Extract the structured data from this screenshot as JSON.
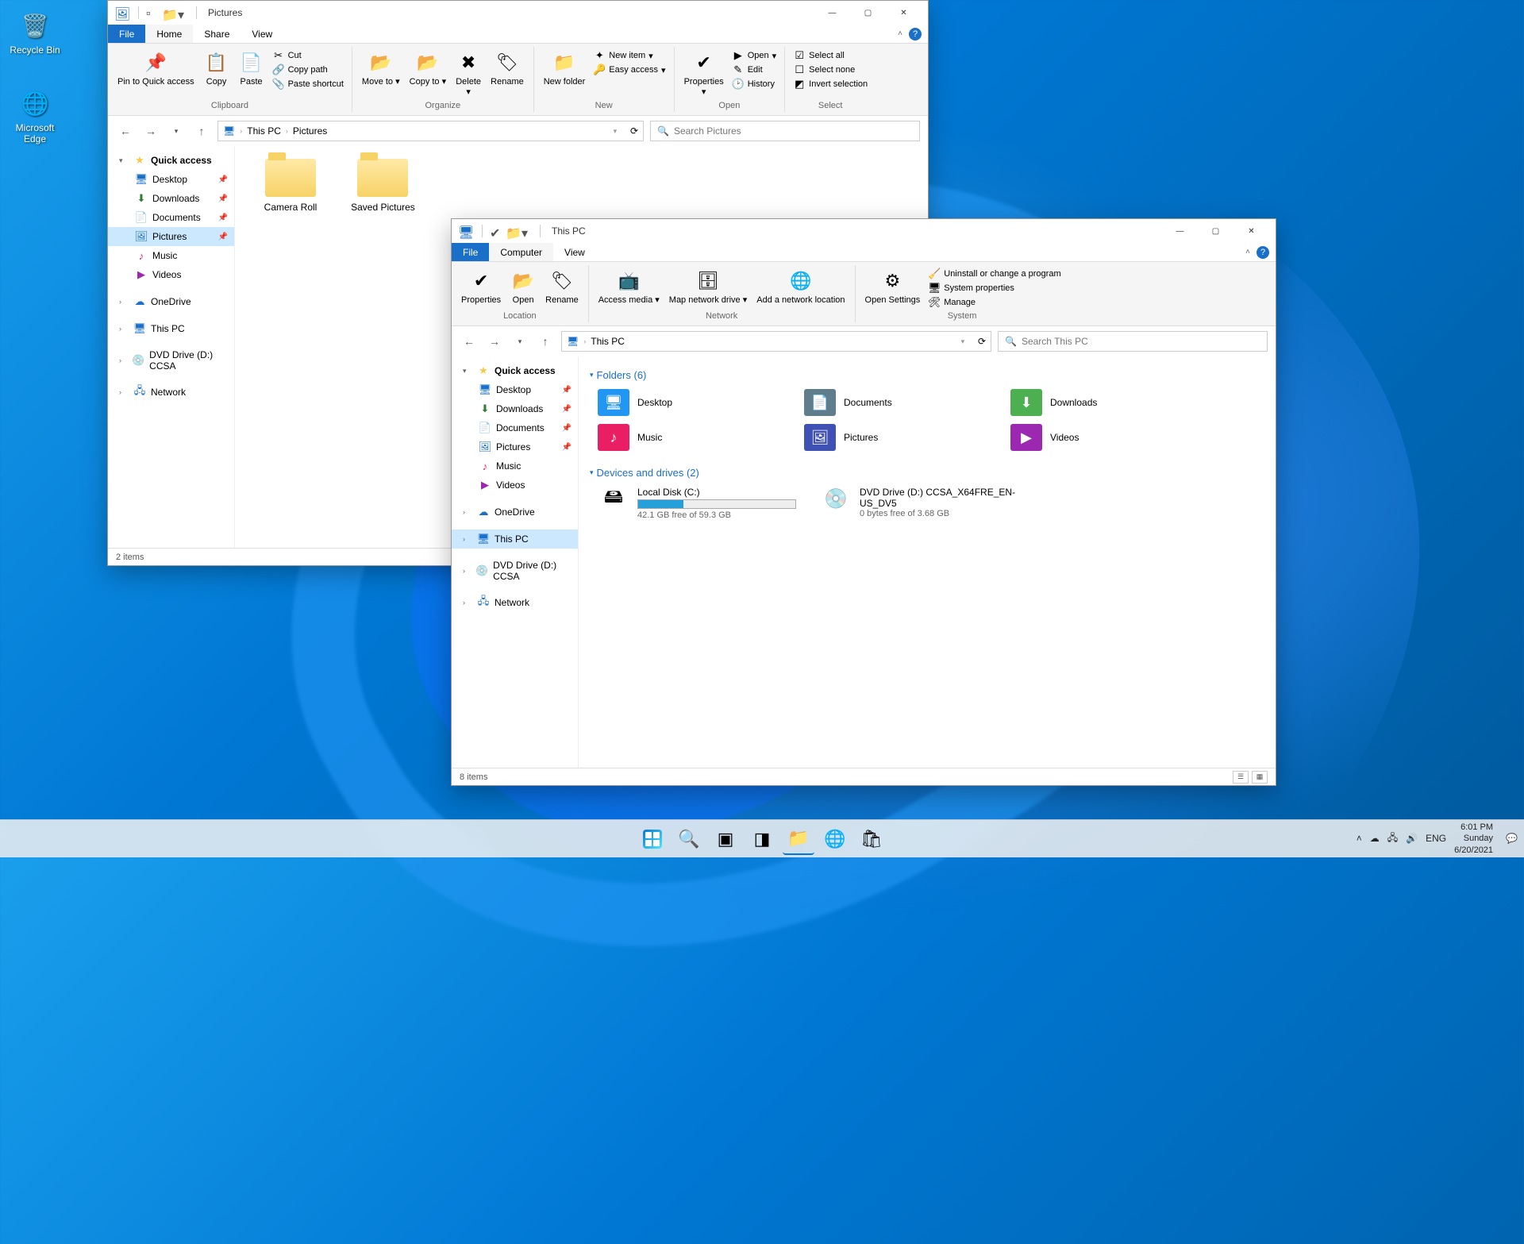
{
  "desktop": {
    "icons": [
      {
        "name": "Recycle Bin"
      },
      {
        "name": "Microsoft Edge"
      }
    ]
  },
  "win1": {
    "title": "Pictures",
    "tabs": {
      "file": "File",
      "home": "Home",
      "share": "Share",
      "view": "View"
    },
    "ribbon": {
      "clipboard": {
        "label": "Clipboard",
        "pin": "Pin to Quick access",
        "copy": "Copy",
        "paste": "Paste",
        "cut": "Cut",
        "copypath": "Copy path",
        "shortcut": "Paste shortcut"
      },
      "organize": {
        "label": "Organize",
        "move": "Move to",
        "copyto": "Copy to",
        "delete": "Delete",
        "rename": "Rename"
      },
      "new": {
        "label": "New",
        "folder": "New folder",
        "item": "New item",
        "easy": "Easy access"
      },
      "open": {
        "label": "Open",
        "props": "Properties",
        "open": "Open",
        "edit": "Edit",
        "history": "History"
      },
      "select": {
        "label": "Select",
        "all": "Select all",
        "none": "Select none",
        "invert": "Invert selection"
      }
    },
    "breadcrumb": {
      "root": "This PC",
      "leaf": "Pictures"
    },
    "search_ph": "Search Pictures",
    "nav": {
      "quick": "Quick access",
      "desktop": "Desktop",
      "downloads": "Downloads",
      "documents": "Documents",
      "pictures": "Pictures",
      "music": "Music",
      "videos": "Videos",
      "onedrive": "OneDrive",
      "thispc": "This PC",
      "dvd": "DVD Drive (D:) CCSA",
      "network": "Network"
    },
    "folders": [
      {
        "name": "Camera Roll"
      },
      {
        "name": "Saved Pictures"
      }
    ],
    "status": "2 items"
  },
  "win2": {
    "title": "This PC",
    "tabs": {
      "file": "File",
      "computer": "Computer",
      "view": "View"
    },
    "ribbon": {
      "location": {
        "label": "Location",
        "props": "Properties",
        "open": "Open",
        "rename": "Rename"
      },
      "network": {
        "label": "Network",
        "media": "Access media",
        "map": "Map network drive",
        "addloc": "Add a network location"
      },
      "system": {
        "label": "System",
        "settings": "Open Settings",
        "uninstall": "Uninstall or change a program",
        "sysprops": "System properties",
        "manage": "Manage"
      }
    },
    "breadcrumb": {
      "root": "This PC"
    },
    "search_ph": "Search This PC",
    "nav": {
      "quick": "Quick access",
      "desktop": "Desktop",
      "downloads": "Downloads",
      "documents": "Documents",
      "pictures": "Pictures",
      "music": "Music",
      "videos": "Videos",
      "onedrive": "OneDrive",
      "thispc": "This PC",
      "dvd": "DVD Drive (D:) CCSA",
      "network": "Network"
    },
    "sections": {
      "folders_h": "Folders (6)",
      "folders": [
        {
          "name": "Desktop",
          "cls": "folder-desktop",
          "glyph": "🖥"
        },
        {
          "name": "Documents",
          "cls": "folder-docs",
          "glyph": "📄"
        },
        {
          "name": "Downloads",
          "cls": "folder-down",
          "glyph": "⬇"
        },
        {
          "name": "Music",
          "cls": "folder-music",
          "glyph": "♪"
        },
        {
          "name": "Pictures",
          "cls": "folder-pics",
          "glyph": "🖼"
        },
        {
          "name": "Videos",
          "cls": "folder-videos",
          "glyph": "▶"
        }
      ],
      "drives_h": "Devices and drives (2)",
      "localdisk": {
        "name": "Local Disk (C:)",
        "free": "42.1 GB free of 59.3 GB",
        "fill": 29
      },
      "dvd": {
        "name": "DVD Drive (D:)",
        "sub": "CCSA_X64FRE_EN-US_DV5",
        "free": "0 bytes free of 3.68 GB"
      }
    },
    "status": "8 items"
  },
  "taskbar": {
    "lang": "ENG",
    "time": "6:01 PM",
    "day": "Sunday",
    "date": "6/20/2021"
  }
}
